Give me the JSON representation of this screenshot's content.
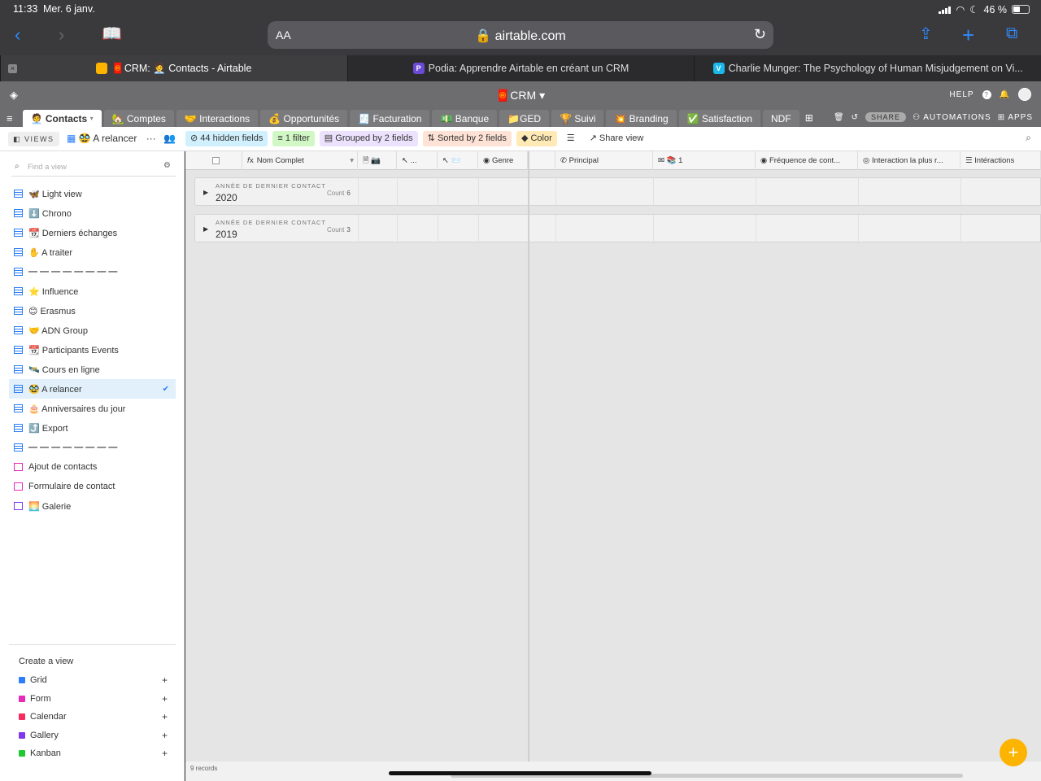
{
  "status": {
    "time": "11:33",
    "date": "Mer. 6 janv.",
    "battery": "46 %",
    "battery_level": 0.46
  },
  "browser": {
    "aa": "AA",
    "url": "airtable.com"
  },
  "tabs": [
    {
      "title": "🧧CRM: 🧑‍💼 Contacts - Airtable",
      "active": true
    },
    {
      "title": "Podia: Apprendre Airtable en créant un CRM",
      "active": false
    },
    {
      "title": "Charlie Munger: The Psychology of Human Misjudgement on Vi...",
      "active": false
    }
  ],
  "app": {
    "base_title": "🧧CRM",
    "help": "HELP",
    "share": "SHARE",
    "automations": "AUTOMATIONS",
    "apps": "APPS"
  },
  "tables": [
    "🧑‍💼 Contacts",
    "🏡 Comptes",
    "🤝 Interactions",
    "💰 Opportunités",
    "🧾 Facturation",
    "💵 Banque",
    "📁GED",
    "🏆 Suivi",
    "💥 Branding",
    "✅ Satisfaction",
    "NDF"
  ],
  "viewbar": {
    "views_label": "VIEWS",
    "current_view": "🥸 A relancer",
    "hidden_fields": "44 hidden fields",
    "filter": "1 filter",
    "grouped": "Grouped by 2 fields",
    "sorted": "Sorted by 2 fields",
    "color": "Color",
    "share_view": "Share view"
  },
  "sidebar": {
    "search_placeholder": "Find a view",
    "views": [
      {
        "label": "🦋 Light view",
        "type": "grid"
      },
      {
        "label": "⬇️ Chrono",
        "type": "grid"
      },
      {
        "label": "📆 Derniers échanges",
        "type": "grid"
      },
      {
        "label": "✋ A traiter",
        "type": "grid"
      },
      {
        "label": "— — — — — — — —",
        "type": "grid"
      },
      {
        "label": "⭐ Influence",
        "type": "grid"
      },
      {
        "label": "😊 Erasmus",
        "type": "grid"
      },
      {
        "label": "🤝 ADN Group",
        "type": "grid"
      },
      {
        "label": "📆 Participants Events",
        "type": "grid"
      },
      {
        "label": "🛰️ Cours en ligne",
        "type": "grid"
      },
      {
        "label": "🥸 A relancer",
        "type": "grid",
        "selected": true
      },
      {
        "label": "🎂 Anniversaires du jour",
        "type": "grid"
      },
      {
        "label": "⤴️ Export",
        "type": "grid"
      },
      {
        "label": "— — — — — — — —",
        "type": "grid"
      },
      {
        "label": "Ajout de contacts",
        "type": "form"
      },
      {
        "label": "Formulaire de contact",
        "type": "form"
      },
      {
        "label": "🌅 Galerie",
        "type": "gallery"
      }
    ],
    "create_heading": "Create a view",
    "create_options": [
      {
        "label": "Grid",
        "color": "#2d7ff9"
      },
      {
        "label": "Form",
        "color": "#e929ba"
      },
      {
        "label": "Calendar",
        "color": "#f82b60"
      },
      {
        "label": "Gallery",
        "color": "#7c39ed"
      },
      {
        "label": "Kanban",
        "color": "#20c933"
      }
    ]
  },
  "grid": {
    "headers": [
      "Nom Complet",
      "📷",
      "...",
      "📨",
      "Genre",
      "Principal",
      "📚 1",
      "Fréquence de cont...",
      "Interaction la plus r...",
      "Intéractions"
    ],
    "groups": [
      {
        "label": "ANNÉE DE DERNIER CONTACT",
        "value": "2020",
        "count_label": "Count",
        "count": "6"
      },
      {
        "label": "ANNÉE DE DERNIER CONTACT",
        "value": "2019",
        "count_label": "Count",
        "count": "3"
      }
    ],
    "records": "9 records"
  },
  "colors": {
    "accent": "#2d7ff9",
    "fab": "#fcb400"
  }
}
